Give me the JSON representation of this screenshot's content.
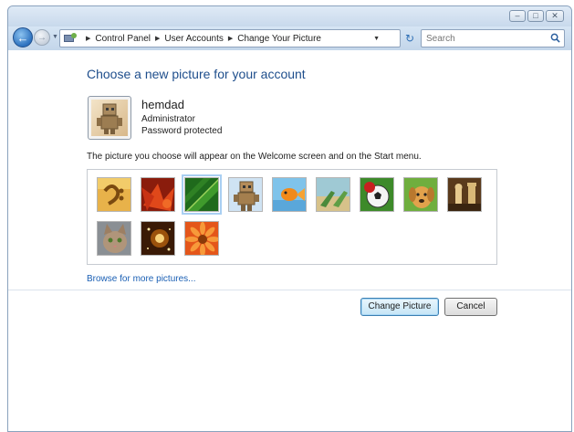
{
  "breadcrumb": [
    "Control Panel",
    "User Accounts",
    "Change Your Picture"
  ],
  "search": {
    "placeholder": "Search"
  },
  "page": {
    "heading": "Choose a new picture for your account",
    "info": "The picture you choose will appear on the Welcome screen and on the Start menu.",
    "browse_link": "Browse for more pictures..."
  },
  "user": {
    "name": "hemdad",
    "role": "Administrator",
    "password_status": "Password protected"
  },
  "pictures": [
    {
      "name": "guitar",
      "selected": false
    },
    {
      "name": "leaves",
      "selected": false
    },
    {
      "name": "green-leaf",
      "selected": true
    },
    {
      "name": "robot",
      "selected": false
    },
    {
      "name": "fish",
      "selected": false
    },
    {
      "name": "beach-chairs",
      "selected": false
    },
    {
      "name": "soccer-ball",
      "selected": false
    },
    {
      "name": "dog",
      "selected": false
    },
    {
      "name": "chess",
      "selected": false
    },
    {
      "name": "kitten",
      "selected": false
    },
    {
      "name": "sparkles",
      "selected": false
    },
    {
      "name": "flower",
      "selected": false
    }
  ],
  "buttons": {
    "change": "Change Picture",
    "cancel": "Cancel"
  },
  "colors": {
    "heading": "#1e4e8c",
    "link": "#1a5fb4",
    "frame": "#c9dbee"
  }
}
